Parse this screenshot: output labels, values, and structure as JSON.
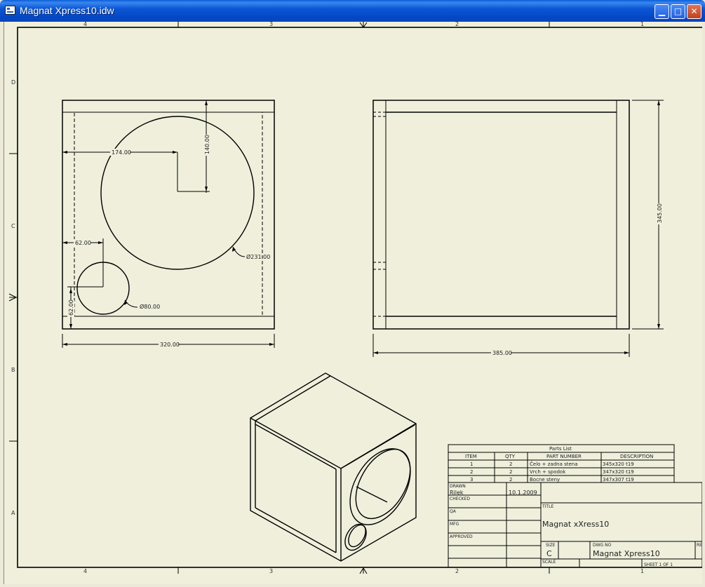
{
  "window": {
    "title": "Magnat Xpress10.idw"
  },
  "controls": {
    "minimize_glyph": "▁",
    "maximize_glyph": "□",
    "close_glyph": "✕"
  },
  "border": {
    "col_labels": [
      "4",
      "3",
      "2",
      "1"
    ],
    "row_labels": [
      "D",
      "C",
      "B",
      "A"
    ]
  },
  "dimensions": {
    "front_width": "320.00",
    "big_hole_x": "174.00",
    "big_hole_y": "140.00",
    "small_hole_x": "62.00",
    "small_hole_y": "62.00",
    "big_hole_dia": "Ø231.00",
    "small_hole_dia": "Ø80.00",
    "side_width": "385.00",
    "side_height": "345.00"
  },
  "parts_list": {
    "title": "Parts List",
    "headers": [
      "ITEM",
      "QTY",
      "PART NUMBER",
      "DESCRIPTION"
    ],
    "rows": [
      [
        "1",
        "2",
        "Čelo + zadna stena",
        "345x320 t19"
      ],
      [
        "2",
        "2",
        "Vrch + spodok",
        "347x320 t19"
      ],
      [
        "3",
        "2",
        "Bocne steny",
        "347x307 t19"
      ]
    ]
  },
  "title_block": {
    "drawn_label": "DRAWN",
    "drawn_by": "Rilek",
    "drawn_date": "10.1.2009",
    "checked_label": "CHECKED",
    "qa_label": "QA",
    "mfg_label": "MFG",
    "approved_label": "APPROVED",
    "title_label": "TITLE",
    "title_value": "Magnat xXress10",
    "size_label": "SIZE",
    "size_value": "C",
    "dwg_no_label": "DWG NO",
    "dwg_no_value": "Magnat Xpress10",
    "rev_label": "RE",
    "scale_label": "SCALE",
    "sheet_label": "SHEET 1  OF 1"
  }
}
